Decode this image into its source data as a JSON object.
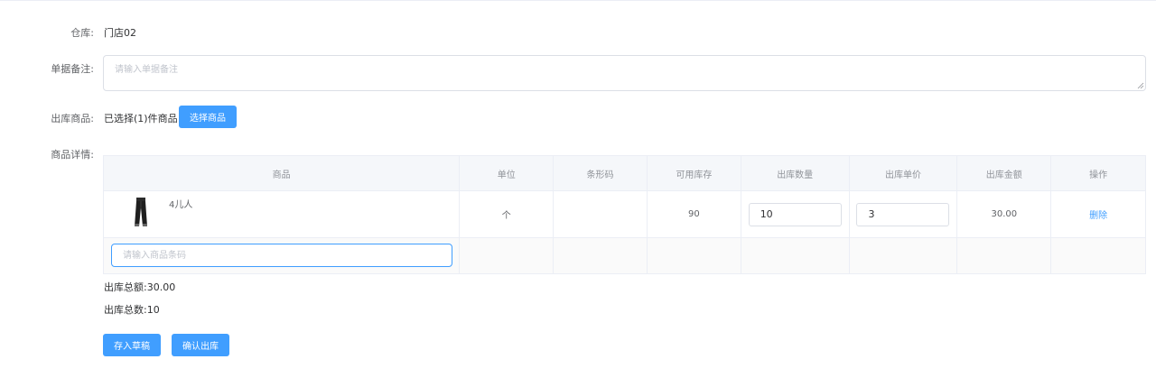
{
  "form": {
    "warehouse_label": "仓库:",
    "warehouse_value": "门店02",
    "remark_label": "单据备注:",
    "remark_placeholder": "请输入单据备注",
    "remark_value": "",
    "goods_label": "出库商品:",
    "goods_selected_text": "已选择(1)件商品",
    "select_goods_button": "选择商品",
    "details_label": "商品详情:"
  },
  "table": {
    "headers": [
      "商品",
      "单位",
      "条形码",
      "可用库存",
      "出库数量",
      "出库单价",
      "出库金额",
      "操作"
    ],
    "rows": [
      {
        "image_icon": "pants-icon",
        "name": "4儿人",
        "unit": "个",
        "barcode": "",
        "stock": "90",
        "quantity": "10",
        "unit_price": "3",
        "amount": "30.00",
        "action": "删除"
      }
    ],
    "barcode_placeholder": "请输入商品条码",
    "barcode_value": ""
  },
  "summary": {
    "total_amount_label": "出库总额:",
    "total_amount_value": "30.00",
    "total_count_label": "出库总数:",
    "total_count_value": "10"
  },
  "actions": {
    "save_draft": "存入草稿",
    "confirm": "确认出库"
  },
  "colors": {
    "primary": "#409eff",
    "border": "#dcdfe6",
    "header_bg": "#f5f7fa",
    "text": "#303133",
    "muted": "#606266",
    "placeholder": "#c0c4cc"
  }
}
